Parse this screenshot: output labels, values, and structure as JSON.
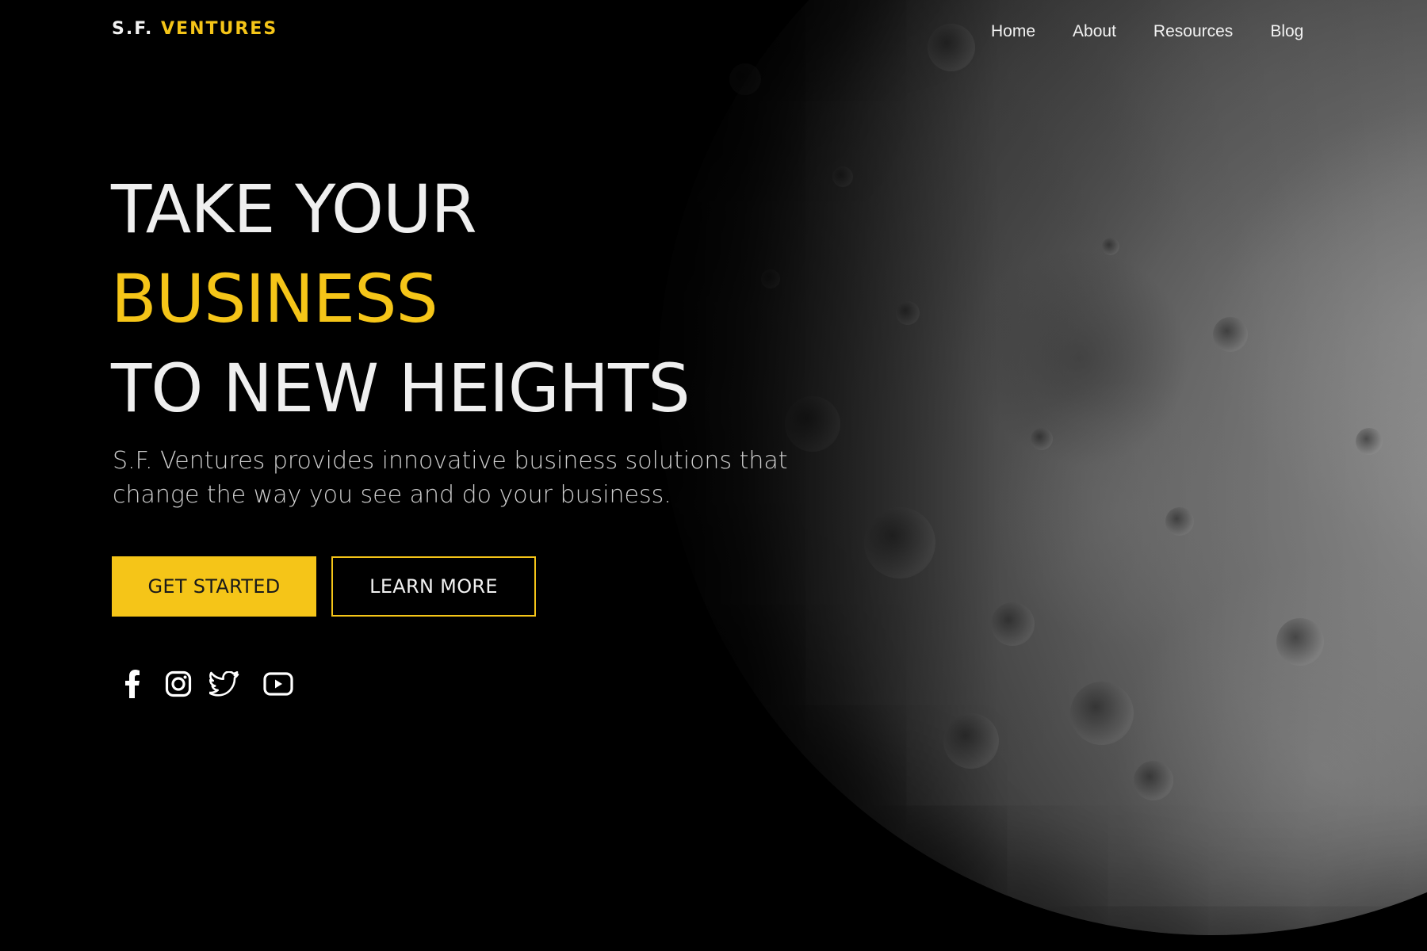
{
  "brand": {
    "name_part1": "S.F.",
    "name_part2": "VENTURES",
    "accent_color": "#f5c518"
  },
  "nav": {
    "items": [
      {
        "label": "Home"
      },
      {
        "label": "About"
      },
      {
        "label": "Resources"
      },
      {
        "label": "Blog"
      }
    ]
  },
  "hero": {
    "line1": "TAKE YOUR",
    "line2": "BUSINESS",
    "line3": "TO NEW HEIGHTS",
    "subtitle": "S.F. Ventures provides innovative business solutions that change the way you see and do your business."
  },
  "buttons": {
    "primary_label": "GET STARTED",
    "secondary_label": "LEARN MORE"
  },
  "social": {
    "icons": [
      "facebook-icon",
      "instagram-icon",
      "twitter-icon",
      "youtube-icon"
    ]
  }
}
